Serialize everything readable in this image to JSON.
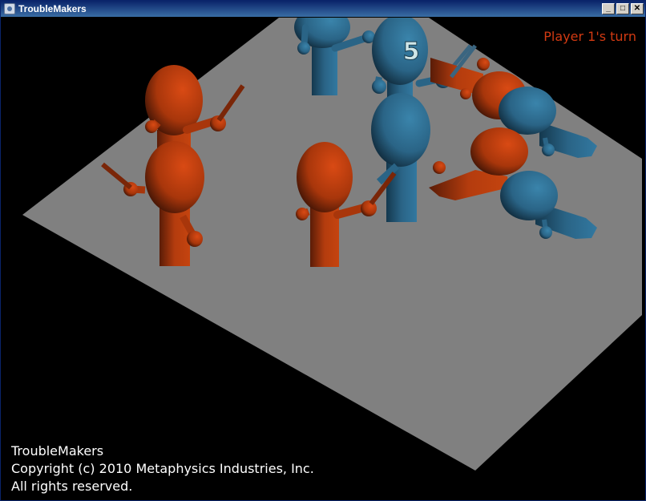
{
  "window": {
    "title": "TroubleMakers",
    "minimize_label": "_",
    "maximize_label": "□",
    "close_label": "✕"
  },
  "hud": {
    "turn_text": "Player 1's turn",
    "selected_piece_number": "5"
  },
  "credits": {
    "line1": "TroubleMakers",
    "line2": "Copyright (c) 2010 Metaphysics Industries, Inc.",
    "line3": "All rights reserved."
  },
  "colors": {
    "red_team": "#c0410e",
    "blue_team": "#2e6f93",
    "board": "#808080",
    "background": "#000000",
    "turn_text": "#d23a12"
  },
  "icons": {
    "app": "game-app-icon"
  }
}
